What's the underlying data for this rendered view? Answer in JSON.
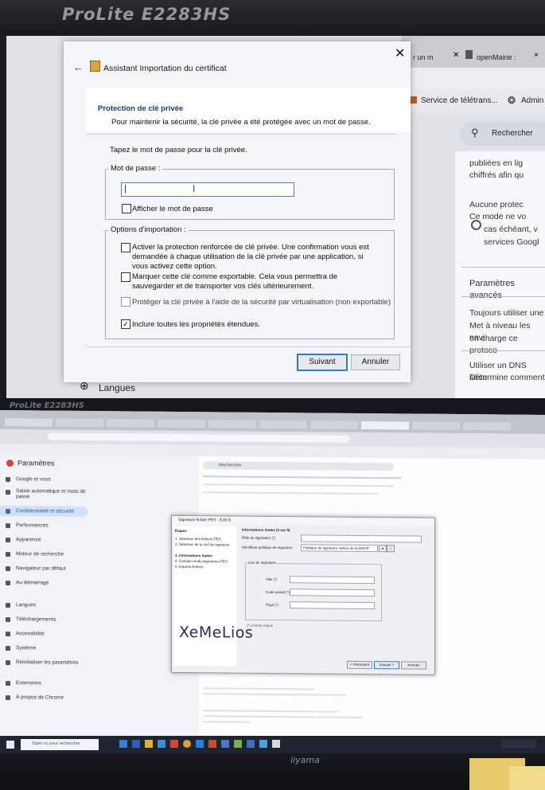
{
  "top": {
    "monitor_brand": "ProLite E2283HS",
    "chrome": {
      "tabs": [
        "r un m",
        "openMairie :",
        "×"
      ],
      "bookmarks": [
        "Service de télétrans...",
        "Admin"
      ],
      "search_label": "Rechercher",
      "lines": [
        "publiées en lig",
        "chiffrés afin qu",
        "Aucune protec",
        "Ce mode ne vo",
        "cas échéant, v",
        "services Googl",
        "Paramètres avancés",
        "Toujours utiliser une",
        "Met à niveau les navi",
        "en charge ce protoco",
        "Utiliser un DNS sécu",
        "Détermine comment"
      ],
      "langues_label": "Langues"
    },
    "dialog": {
      "title": "Assistant Importation du certificat",
      "section_title": "Protection de clé privée",
      "section_desc": "Pour maintenir la sécurité, la clé privée a été protégée avec un mot de passe.",
      "prompt": "Tapez le mot de passe pour la clé privée.",
      "password_group_label": "Mot de passe :",
      "password_value": "",
      "show_password_label": "Afficher le mot de passe",
      "import_options_label": "Options d'importation :",
      "options": [
        {
          "label": "Activer la protection renforcée de clé privée. Une confirmation vous est demandée à chaque utilisation de la clé privée par une application, si vous activez cette option.",
          "checked": false,
          "disabled": false
        },
        {
          "label": "Marquer cette clé comme exportable. Cela vous permettra de sauvegarder et de transporter vos clés ultérieurement.",
          "checked": false,
          "disabled": false
        },
        {
          "label": "Protéger la clé privée à l'aide de la sécurité par virtualisation (non exportable)",
          "checked": false,
          "disabled": true
        },
        {
          "label": "Inclure toutes les propriétés étendues.",
          "checked": true,
          "disabled": false
        }
      ],
      "next_button": "Suivant",
      "cancel_button": "Annuler"
    }
  },
  "bottom": {
    "monitor_brand": "ProLite E2283HS",
    "bottom_brand": "iiyama",
    "settings_title": "Paramètres",
    "settings_search": "Rechercher",
    "sidebar": [
      "Google et vous",
      "Saisie automatique et mots de passe",
      "Confidentialité et sécurité",
      "Performances",
      "Apparence",
      "Moteur de recherche",
      "Navigateur par défaut",
      "Au démarrage",
      "Langues",
      "Téléchargements",
      "Accessibilité",
      "Système",
      "Réinitialiser les paramètres",
      "Extensions",
      "À propos de Chrome"
    ],
    "dialog": {
      "title": "Signature fichier PES - 8.00.9",
      "steps_header": "Étapes",
      "steps": [
        "1. Sélection des fichiers PES",
        "2. Sélection de la clef de signature",
        "3. Informations Xades",
        "4. Compte-rendu signatures PES",
        "5. Imports fichiers"
      ],
      "logo": "XeMeLios",
      "section": "Informations Xades (3 sur 5)",
      "field_role": "Rôle du signataire (*)",
      "field_policy": "Identifiant politique de signature",
      "policy_value": "Politique de signature Helios de la DGFiP",
      "place_header": "Lieu de signature",
      "place_fields": [
        "Ville (*)",
        "Code postal (*)",
        "Pays (*)"
      ],
      "required_note": "(*) champ requis",
      "buttons": [
        "< Précédent",
        "Suivant >",
        "Annuler"
      ]
    },
    "search_placeholder": "Taper ici pour rechercher"
  }
}
